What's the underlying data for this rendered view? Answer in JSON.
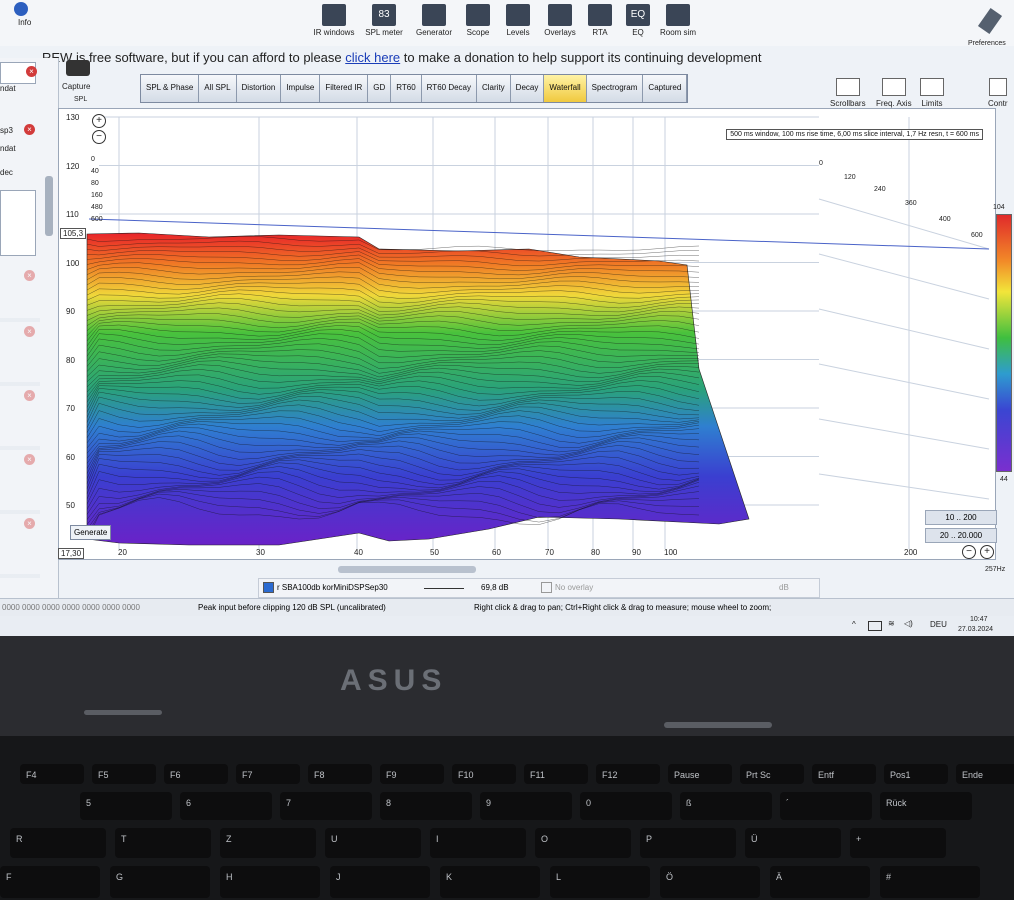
{
  "toolbar": {
    "tools": [
      {
        "label": "IR windows",
        "icon": "ir-windows-icon"
      },
      {
        "label": "SPL meter",
        "icon": "spl-meter-icon",
        "glyph": "83"
      },
      {
        "label": "Generator",
        "icon": "generator-icon"
      },
      {
        "label": "Scope",
        "icon": "scope-icon"
      },
      {
        "label": "Levels",
        "icon": "levels-icon"
      },
      {
        "label": "Overlays",
        "icon": "overlays-icon"
      },
      {
        "label": "RTA",
        "icon": "rta-icon"
      },
      {
        "label": "EQ",
        "icon": "eq-icon",
        "glyph": "EQ"
      },
      {
        "label": "Room sim",
        "icon": "room-sim-icon"
      }
    ],
    "info_label": "Info",
    "preferences_label": "Preferences"
  },
  "donate": {
    "before": "REW is free software, but if you can afford to please ",
    "link": "click here",
    "after": " to make a donation to help support its continuing development"
  },
  "capture": {
    "label": "Capture",
    "sub": "SPL"
  },
  "tabs": [
    "SPL & Phase",
    "All SPL",
    "Distortion",
    "Impulse",
    "Filtered IR",
    "GD",
    "RT60",
    "RT60 Decay",
    "Clarity",
    "Decay",
    "Waterfall",
    "Spectrogram",
    "Captured"
  ],
  "active_tab": "Waterfall",
  "right_controls": [
    "Scrollbars",
    "Freq. Axis",
    "Limits",
    "Contr"
  ],
  "sidebar": {
    "items": [
      "sp3",
      "ndat",
      "dec"
    ],
    "labels_lower": [
      "ndat",
      "ndat",
      "ded"
    ]
  },
  "plot": {
    "info": "500 ms window, 100 ms rise time, 6,00 ms slice interval, 1,7 Hz resn, t = 600 ms",
    "y_ticks": [
      "130",
      "120",
      "110",
      "100",
      "90",
      "80",
      "70",
      "60",
      "50"
    ],
    "y_cursor": "105,3",
    "x_ticks": [
      "20",
      "30",
      "40",
      "50",
      "60",
      "70",
      "80",
      "90",
      "100",
      "200"
    ],
    "x_cursor": "17,30",
    "x_end": "257Hz",
    "time_labels_left": [
      "0",
      "40",
      "80",
      "160",
      "480",
      "600"
    ],
    "time_labels_right": [
      "0",
      "120",
      "240",
      "360",
      "400",
      "600"
    ],
    "range_buttons": [
      "10 .. 200",
      "20 .. 20.000"
    ],
    "generate_label": "Generate",
    "colorbar_top": "104",
    "colorbar_bottom": "44"
  },
  "legend": {
    "checkbox_label": "r SBA100db korMiniDSPSep30",
    "value": "69,8 dB",
    "no_overlay": "No overlay",
    "unit": "dB"
  },
  "status": {
    "left": "0000 0000 0000 0000 0000 0000 0000",
    "peak": "Peak input before clipping 120 dB SPL (uncalibrated)",
    "hint": "Right click & drag to pan; Ctrl+Right click & drag to measure; mouse wheel to zoom;"
  },
  "tray": {
    "lang": "DEU",
    "time": "10:47",
    "date": "27.03.2024"
  },
  "laptop": {
    "brand": "ASUS"
  },
  "keyboard": {
    "row1": [
      "F4",
      "F5",
      "F6",
      "F7",
      "F8",
      "F9",
      "F10",
      "F11",
      "F12",
      "Pause",
      "Prt Sc",
      "Entf",
      "Pos1",
      "Ende"
    ],
    "row2": [
      "5",
      "6",
      "7",
      "8",
      "9",
      "0",
      "ß",
      "´",
      "Rück"
    ],
    "row3": [
      "R",
      "T",
      "Z",
      "U",
      "I",
      "O",
      "P",
      "Ü",
      "+"
    ],
    "row4": [
      "F",
      "G",
      "H",
      "J",
      "K",
      "L",
      "Ö",
      "Ä",
      "#"
    ]
  }
}
